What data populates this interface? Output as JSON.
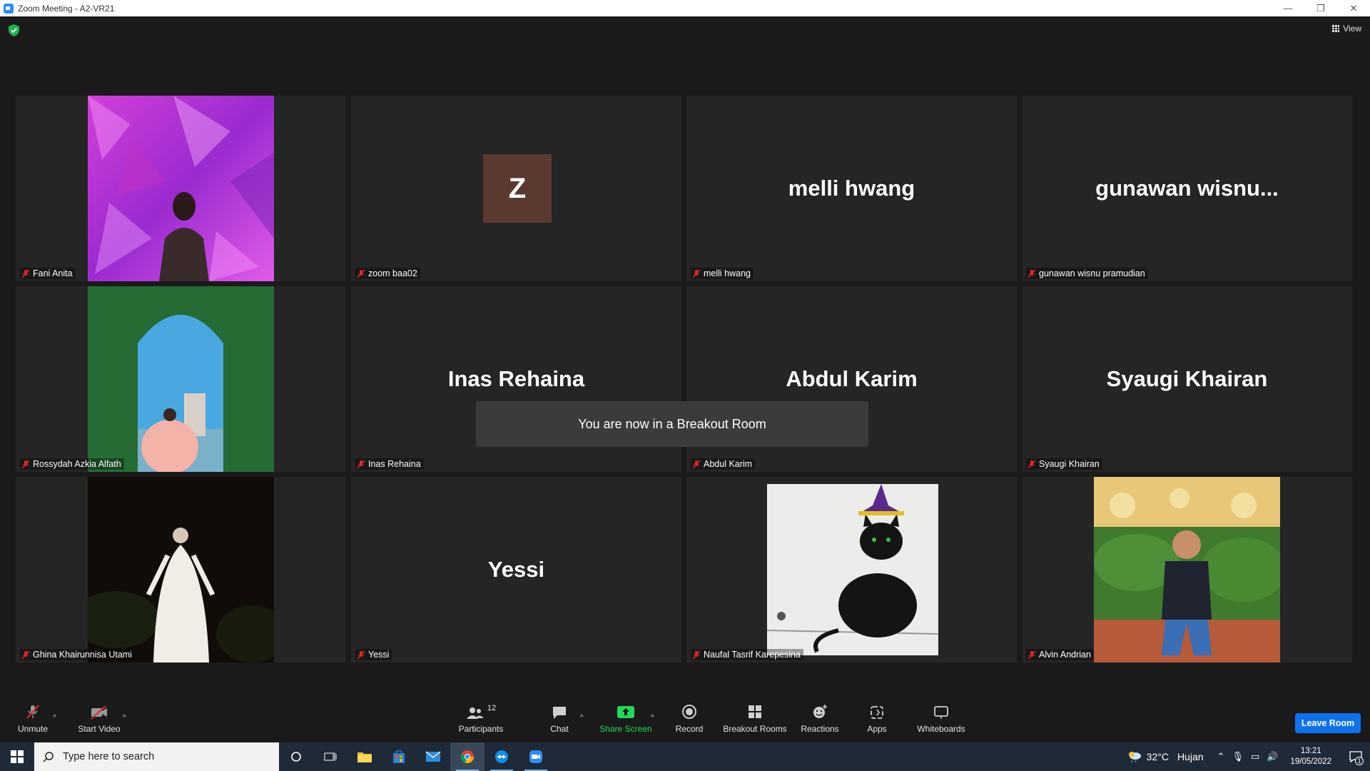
{
  "window": {
    "title": "Zoom Meeting - A2-VR21",
    "minimize": "—",
    "restore": "❐",
    "close": "✕"
  },
  "view_button": {
    "label": "View"
  },
  "tiles": [
    {
      "label": "Fani Anita",
      "display": ""
    },
    {
      "label": "zoom baa02",
      "display": "",
      "avatar_letter": "Z"
    },
    {
      "label": "melli hwang",
      "display": "melli hwang"
    },
    {
      "label": "gunawan wisnu pramudian",
      "display": "gunawan  wisnu..."
    },
    {
      "label": "Rossydah Azkia Alfath",
      "display": ""
    },
    {
      "label": "Inas Rehaina",
      "display": "Inas Rehaina"
    },
    {
      "label": "Abdul Karim",
      "display": "Abdul Karim"
    },
    {
      "label": "Syaugi Khairan",
      "display": "Syaugi Khairan"
    },
    {
      "label": "Ghina Khairunnisa Utami",
      "display": ""
    },
    {
      "label": "Yessi",
      "display": "Yessi"
    },
    {
      "label": "Naufal Tasrif Karepesina",
      "display": ""
    },
    {
      "label": "Alvin Andrian",
      "display": ""
    }
  ],
  "toast": "You are now in a Breakout Room",
  "toolbar": {
    "unmute": "Unmute",
    "start_video": "Start Video",
    "participants": "Participants",
    "participants_count": "12",
    "chat": "Chat",
    "share_screen": "Share Screen",
    "record": "Record",
    "breakout_rooms": "Breakout Rooms",
    "reactions": "Reactions",
    "apps": "Apps",
    "whiteboards": "Whiteboards",
    "leave": "Leave Room"
  },
  "taskbar": {
    "search_placeholder": "Type here to search",
    "weather_temp": "32°C",
    "weather_text": "Hujan",
    "time": "13:21",
    "date": "19/05/2022",
    "notification_count": "1"
  },
  "colors": {
    "share_green": "#23d959",
    "leave_blue": "#0e72ed",
    "muted_red": "#e02828"
  }
}
